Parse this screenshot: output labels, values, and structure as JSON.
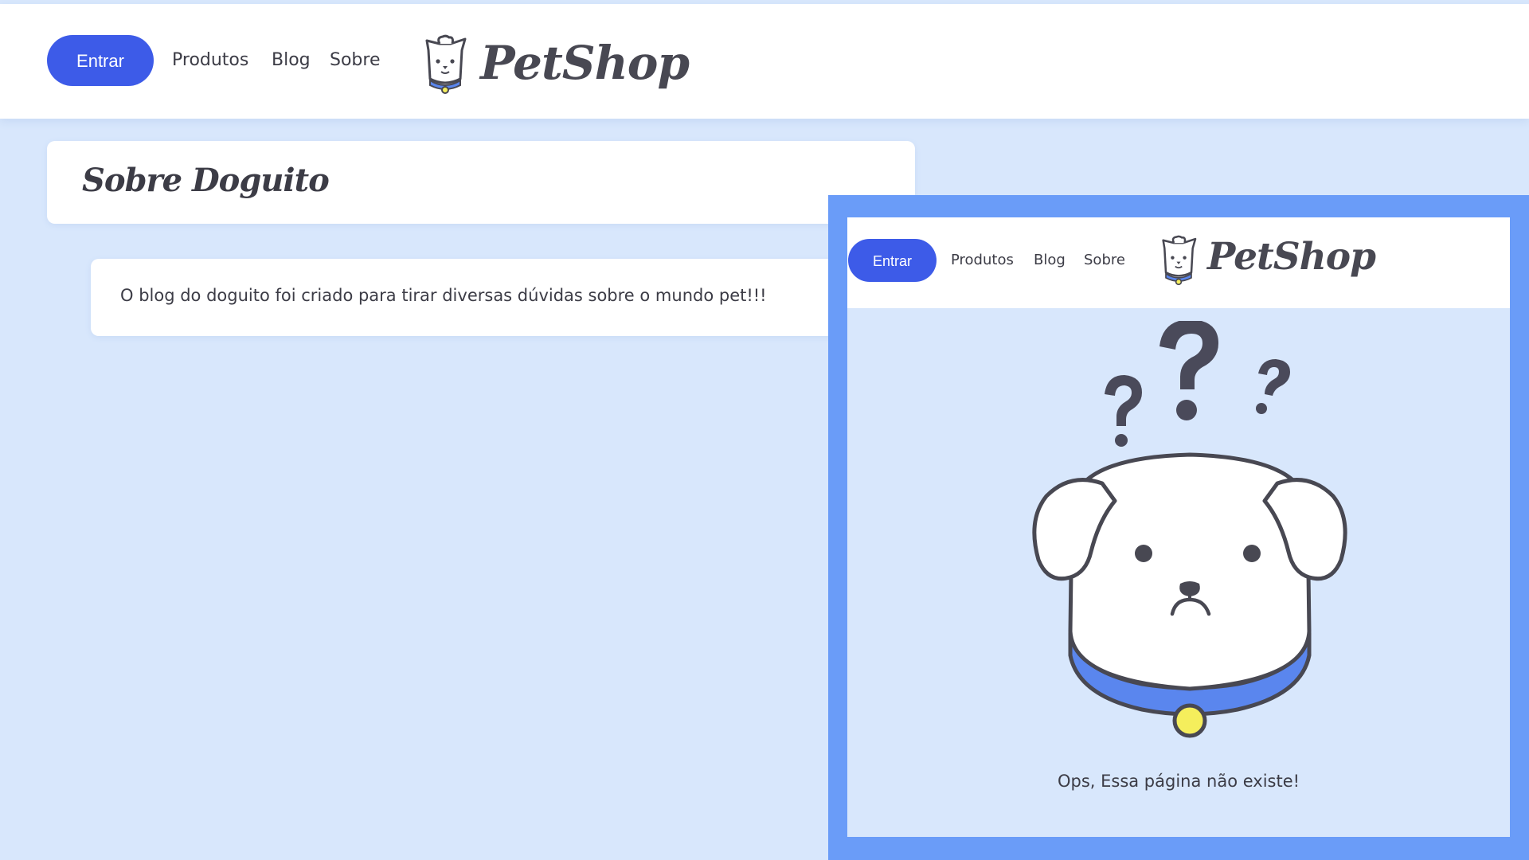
{
  "header": {
    "login_label": "Entrar",
    "nav": [
      "Produtos",
      "Blog",
      "Sobre"
    ],
    "logo_text": "PetShop"
  },
  "page": {
    "title": "Sobre Doguito",
    "description": "O blog do doguito foi criado para tirar diversas dúvidas sobre o mundo pet!!!"
  },
  "overlay": {
    "header": {
      "login_label": "Entrar",
      "nav": [
        "Produtos",
        "Blog",
        "Sobre"
      ],
      "logo_text": "PetShop"
    },
    "error_message": "Ops, Essa página não existe!",
    "illustration": "sad-dog-question-marks"
  },
  "colors": {
    "background": "#d8e7fc",
    "primary_button": "#3d5be8",
    "overlay_frame": "#6a9cf8",
    "collar": "#5a86ee",
    "collar_tag": "#f5ee5c",
    "text": "#3c3c46"
  }
}
